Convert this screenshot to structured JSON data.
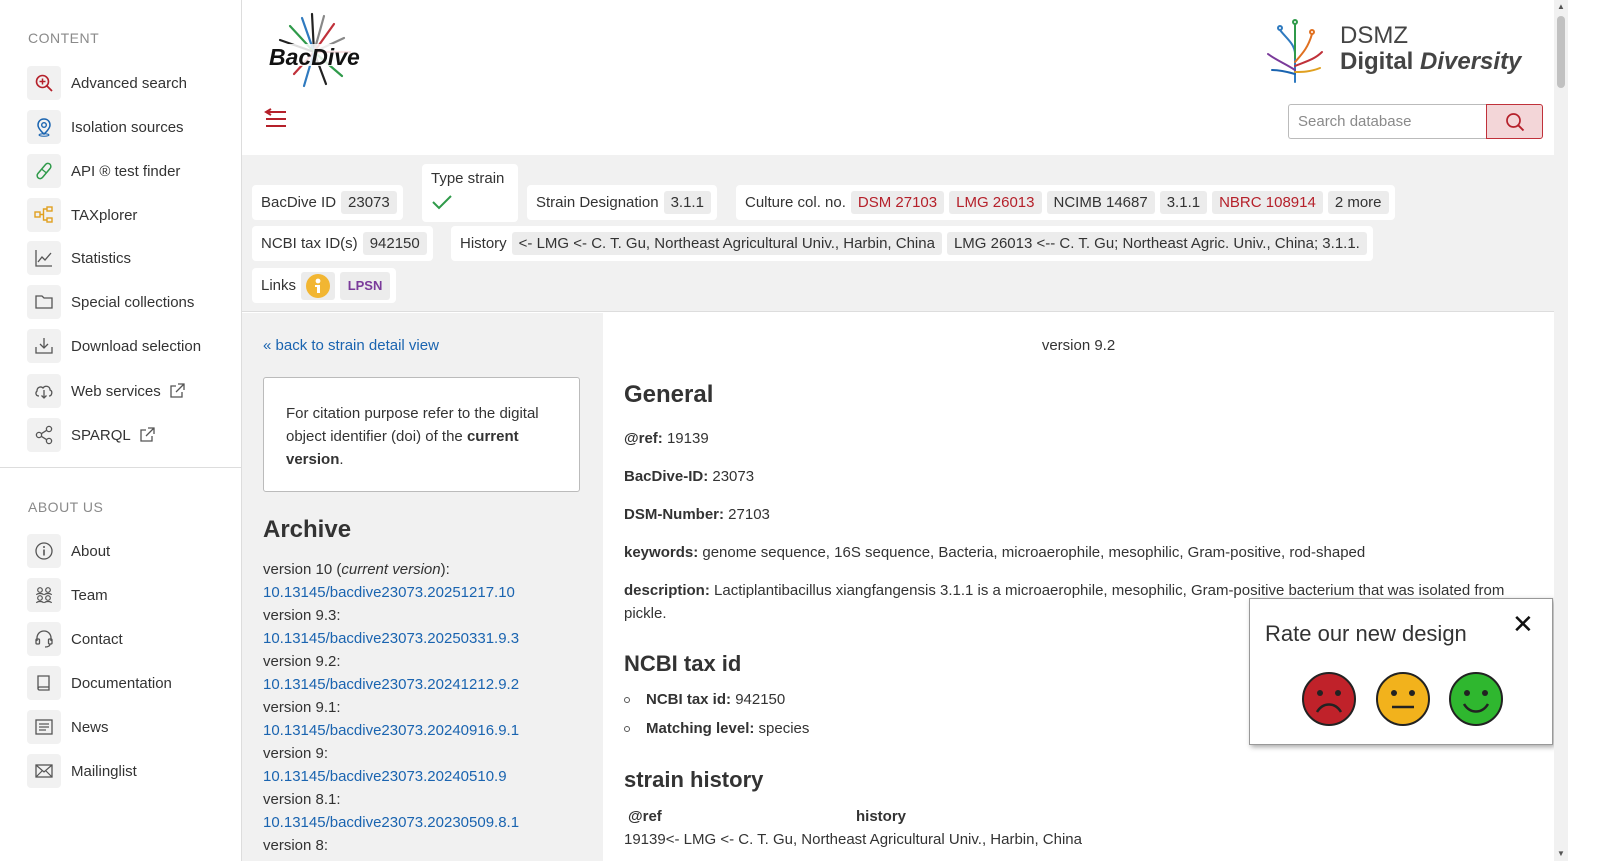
{
  "sidebar": {
    "content_heading": "CONTENT",
    "about_heading": "ABOUT US",
    "content_items": [
      {
        "label": "Advanced search",
        "icon": "search-plus-icon"
      },
      {
        "label": "Isolation sources",
        "icon": "map-pin-icon"
      },
      {
        "label": "API ® test finder",
        "icon": "test-strip-icon"
      },
      {
        "label": "TAXplorer",
        "icon": "tree-icon"
      },
      {
        "label": "Statistics",
        "icon": "chart-line-icon"
      },
      {
        "label": "Special collections",
        "icon": "folder-icon"
      },
      {
        "label": "Download selection",
        "icon": "download-icon"
      },
      {
        "label": "Web services",
        "icon": "cloud-download-icon"
      },
      {
        "label": "SPARQL",
        "icon": "share-nodes-icon"
      }
    ],
    "about_items": [
      {
        "label": "About",
        "icon": "info-icon"
      },
      {
        "label": "Team",
        "icon": "team-icon"
      },
      {
        "label": "Contact",
        "icon": "headset-icon"
      },
      {
        "label": "Documentation",
        "icon": "book-icon"
      },
      {
        "label": "News",
        "icon": "newspaper-icon"
      },
      {
        "label": "Mailinglist",
        "icon": "envelope-icon"
      }
    ]
  },
  "header": {
    "logo_text": "BacDive",
    "dsmz_line1": "DSMZ",
    "dsmz_line2a": "Digital ",
    "dsmz_line2b": "Diversity",
    "search_placeholder": "Search database"
  },
  "strain": {
    "bacdive_id_label": "BacDive ID",
    "bacdive_id": "23073",
    "type_strain_label": "Type strain",
    "designation_label": "Strain Designation",
    "designation": "3.1.1",
    "culture_label": "Culture col. no.",
    "culture_numbers": [
      "DSM 27103",
      "LMG 26013",
      "NCIMB 14687",
      "3.1.1",
      "NBRC 108914",
      "2 more"
    ],
    "ncbi_label": "NCBI tax ID(s)",
    "ncbi_id": "942150",
    "history_label": "History",
    "history_items": [
      "<- LMG <- C. T. Gu, Northeast Agricultural Univ., Harbin, China",
      "LMG 26013 <-- C. T. Gu; Northeast Agric. Univ., China; 3.1.1."
    ],
    "links_label": "Links",
    "lpsn_label": "LPSN"
  },
  "left": {
    "back_link": "« back to strain detail view",
    "cite_text": "For citation purpose refer to the digital object identifier (doi) of the ",
    "cite_bold": "current version",
    "cite_end": ".",
    "archive_title": "Archive",
    "archive": [
      {
        "version": "version 10 (",
        "current": "current version",
        "suffix": "):",
        "doi": "10.13145/bacdive23073.20251217.10"
      },
      {
        "version": "version 9.3:",
        "current": "",
        "suffix": "",
        "doi": "10.13145/bacdive23073.20250331.9.3"
      },
      {
        "version": "version 9.2:",
        "current": "",
        "suffix": "",
        "doi": "10.13145/bacdive23073.20241212.9.2"
      },
      {
        "version": "version 9.1:",
        "current": "",
        "suffix": "",
        "doi": "10.13145/bacdive23073.20240916.9.1"
      },
      {
        "version": "version 9:",
        "current": "",
        "suffix": "",
        "doi": "10.13145/bacdive23073.20240510.9"
      },
      {
        "version": "version 8.1:",
        "current": "",
        "suffix": "",
        "doi": "10.13145/bacdive23073.20230509.8.1"
      },
      {
        "version": "version 8:",
        "current": "",
        "suffix": "",
        "doi": ""
      }
    ]
  },
  "main": {
    "version": "version 9.2",
    "general_title": "General",
    "ref_label": "@ref:",
    "ref_value": "19139",
    "bacdive_label": "BacDive-ID:",
    "bacdive_value": "23073",
    "dsm_label": "DSM-Number:",
    "dsm_value": "27103",
    "keywords_label": "keywords:",
    "keywords_value": "genome sequence, 16S sequence, Bacteria, microaerophile, mesophilic, Gram-positive, rod-shaped",
    "description_label": "description:",
    "description_value": "Lactiplantibacillus xiangfangensis 3.1.1 is a microaerophile, mesophilic, Gram-positive bacterium that was isolated from pickle.",
    "ncbi_title": "NCBI tax id",
    "ncbi_tax_label": "NCBI tax id:",
    "ncbi_tax_value": "942150",
    "matching_label": "Matching level:",
    "matching_value": "species",
    "history_title": "strain history",
    "history_col_ref": "@ref",
    "history_col_history": "history",
    "history_row_ref": "19139",
    "history_row_value": "<- LMG <- C. T. Gu, Northeast Agricultural Univ., Harbin, China"
  },
  "rating": {
    "title": "Rate our new design",
    "close": "✕"
  },
  "colors": {
    "accent_red": "#b5202a",
    "link_blue": "#1a64b0",
    "panel_gray": "#f1f1f1"
  }
}
